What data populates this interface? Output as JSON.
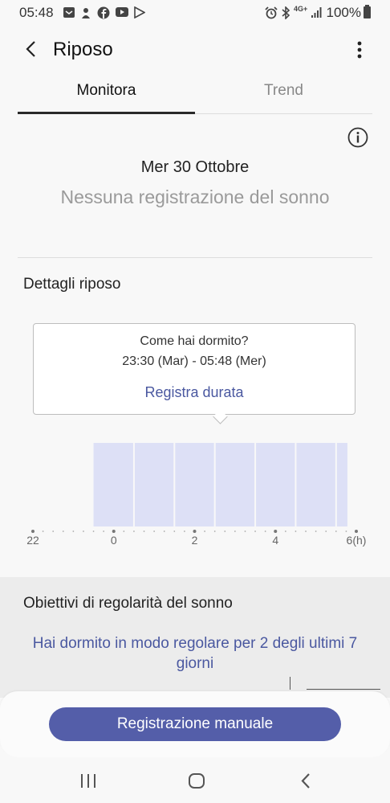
{
  "status_bar": {
    "time": "05:48",
    "network": "4G+",
    "battery": "100%",
    "left_icons": [
      "message-icon",
      "notification-icon",
      "facebook-icon",
      "youtube-icon",
      "play-store-icon"
    ],
    "right_icons": [
      "alarm-icon",
      "bluetooth-icon",
      "signal-icon",
      "battery-icon"
    ]
  },
  "header": {
    "title": "Riposo"
  },
  "tabs": [
    {
      "label": "Monitora",
      "active": true
    },
    {
      "label": "Trend",
      "active": false
    }
  ],
  "monitor": {
    "date": "Mer 30 Ottobre",
    "empty_message": "Nessuna registrazione del sonno"
  },
  "details": {
    "title": "Dettagli riposo",
    "popup": {
      "question": "Come hai dormito?",
      "range": "23:30 (Mar) - 05:48 (Mer)",
      "action": "Registra durata"
    }
  },
  "chart_data": {
    "type": "bar",
    "x_ticks": [
      "22",
      "0",
      "2",
      "4",
      "6(h)"
    ],
    "x_tick_values": [
      22,
      24,
      26,
      28,
      30
    ],
    "xlim": [
      22,
      30
    ],
    "bar_color": "#dde0f6",
    "blocks": [
      {
        "start": 23.5,
        "end": 24.5
      },
      {
        "start": 24.5,
        "end": 25.5
      },
      {
        "start": 25.5,
        "end": 26.5
      },
      {
        "start": 26.5,
        "end": 27.5
      },
      {
        "start": 27.5,
        "end": 28.5
      },
      {
        "start": 28.5,
        "end": 29.5
      },
      {
        "start": 29.5,
        "end": 29.8
      }
    ]
  },
  "regularity": {
    "title": "Obiettivi di regolarità del sonno",
    "text": "Hai dormito in modo regolare per 2 degli ultimi 7 giorni"
  },
  "actions": {
    "manual_record": "Registrazione manuale"
  },
  "colors": {
    "accent": "#545ea9",
    "accent_text": "#4a58a0",
    "bar": "#dde0f6"
  }
}
